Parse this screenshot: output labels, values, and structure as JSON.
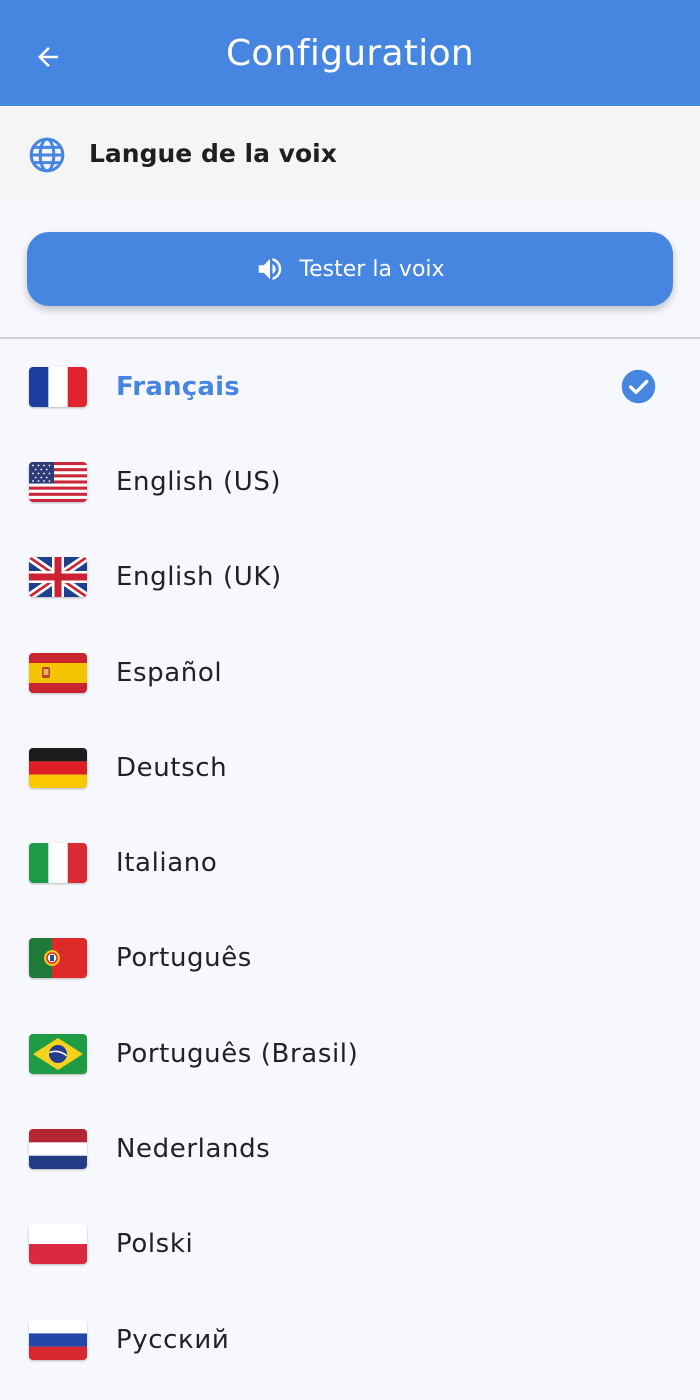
{
  "appbar": {
    "title": "Configuration",
    "back_icon": "arrow-left-icon"
  },
  "section": {
    "icon": "globe-icon",
    "title": "Langue de la voix"
  },
  "test_button": {
    "icon": "speaker-icon",
    "label": "Tester la voix"
  },
  "colors": {
    "accent": "#4686e0",
    "background": "#f7f8fd",
    "header_bg": "#f5f5f5"
  },
  "languages": [
    {
      "label": "Français",
      "flag": "france-flag-icon",
      "selected": true
    },
    {
      "label": "English (US)",
      "flag": "usa-flag-icon",
      "selected": false
    },
    {
      "label": "English (UK)",
      "flag": "uk-flag-icon",
      "selected": false
    },
    {
      "label": "Español",
      "flag": "spain-flag-icon",
      "selected": false
    },
    {
      "label": "Deutsch",
      "flag": "germany-flag-icon",
      "selected": false
    },
    {
      "label": "Italiano",
      "flag": "italy-flag-icon",
      "selected": false
    },
    {
      "label": "Português",
      "flag": "portugal-flag-icon",
      "selected": false
    },
    {
      "label": "Português (Brasil)",
      "flag": "brazil-flag-icon",
      "selected": false
    },
    {
      "label": "Nederlands",
      "flag": "netherlands-flag-icon",
      "selected": false
    },
    {
      "label": "Polski",
      "flag": "poland-flag-icon",
      "selected": false
    },
    {
      "label": "Русский",
      "flag": "russia-flag-icon",
      "selected": false
    }
  ]
}
